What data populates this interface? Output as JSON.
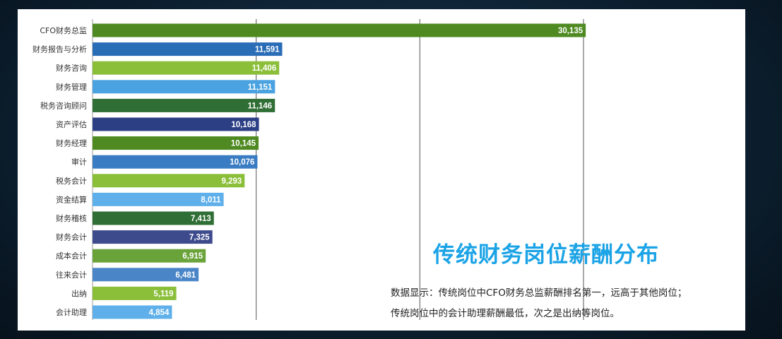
{
  "chart_data": {
    "type": "bar",
    "orientation": "horizontal",
    "title": "传统财务岗位薪酬分布",
    "categories": [
      "CFO财务总监",
      "财务报告与分析",
      "财务咨询",
      "财务管理",
      "税务咨询顾问",
      "资产评估",
      "财务经理",
      "审计",
      "税务会计",
      "资金结算",
      "财务稽核",
      "财务会计",
      "成本会计",
      "往来会计",
      "出纳",
      "会计助理"
    ],
    "values": [
      30135,
      11591,
      11406,
      11151,
      11146,
      10168,
      10145,
      10076,
      9293,
      8011,
      7413,
      7325,
      6915,
      6481,
      5119,
      4854
    ],
    "value_labels": [
      "30,135",
      "11,591",
      "11,406",
      "11,151",
      "11,146",
      "10,168",
      "10,145",
      "10,076",
      "9,293",
      "8,011",
      "7,413",
      "7,325",
      "6,915",
      "6,481",
      "5,119",
      "4,854"
    ],
    "colors": [
      "#4e8a21",
      "#2a6db7",
      "#8bbf3a",
      "#4aa3e0",
      "#2f6e34",
      "#2c3f85",
      "#4e8a21",
      "#3a7cc3",
      "#8bbf3a",
      "#5fb0ea",
      "#2f6e34",
      "#3d4a8c",
      "#6aa33a",
      "#4a86c7",
      "#8bbf3a",
      "#5fb0ea"
    ],
    "xlim": [
      0,
      30000
    ],
    "gridlines": [
      0,
      10000,
      20000,
      30000
    ],
    "grid": true,
    "xlabel": "",
    "ylabel": ""
  },
  "notes": [
    "数据显示：传统岗位中CFO财务总监薪酬排名第一，远高于其他岗位；",
    "传统岗位中的会计助理薪酬最低，次之是出纳等岗位。"
  ]
}
